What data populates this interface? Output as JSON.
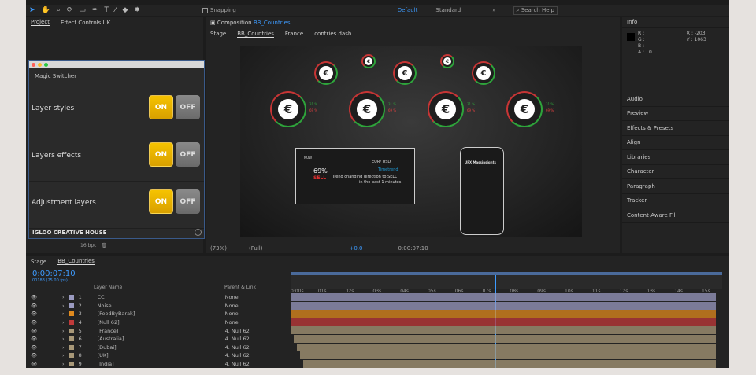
{
  "toolbar": {
    "snapping": "Snapping",
    "workspaces": [
      "Default",
      "Standard"
    ],
    "search": "Search Help"
  },
  "project": {
    "tabs": [
      "Project",
      "Effect Controls UK"
    ]
  },
  "composition": {
    "tab": "Composition",
    "comp": "BB_Countries",
    "breadcrumb": [
      "Stage",
      "BB_Countries",
      "France",
      "contries dash"
    ],
    "zoom": "(73%)",
    "quality": "(Full)",
    "exposure": "+0.0",
    "time": "0:00:07:10"
  },
  "magic": {
    "title": "Magic Switcher",
    "rows": [
      {
        "label": "Layer styles",
        "on": "ON",
        "off": "OFF"
      },
      {
        "label": "Layers effects",
        "on": "ON",
        "off": "OFF"
      },
      {
        "label": "Adjustment layers",
        "on": "ON",
        "off": "OFF"
      }
    ],
    "brand": "IGLOO CREATIVE HOUSE",
    "bpc": "16 bpc"
  },
  "card": {
    "now": "NOW",
    "pair": "EUR/ USD",
    "trend": "Timetrend",
    "pct": "69%",
    "action": "SELL",
    "msg1": "Trend changing direction to SELL",
    "msg2": "in the past 1 minutes"
  },
  "phone": {
    "brand": "UFX Massinsights"
  },
  "coins": {
    "symbol": "€",
    "up": "31 %",
    "down": "69 %"
  },
  "info": {
    "title": "Info",
    "r": "R :",
    "g": "G :",
    "b": "B :",
    "a": "A :",
    "av": "0",
    "x": "X : -203",
    "y": "Y : 1063"
  },
  "panels": [
    "Audio",
    "Preview",
    "Effects & Presets",
    "Align",
    "Libraries",
    "Character",
    "Paragraph",
    "Tracker",
    "Content-Aware Fill"
  ],
  "timeline": {
    "tabs": [
      "Stage",
      "BB_Countries"
    ],
    "time": "0:00:07:10",
    "frames": "00183 (25.00 fps)",
    "col_name": "Layer Name",
    "col_parent": "Parent & Link",
    "ruler": [
      "0:00s",
      "01s",
      "02s",
      "03s",
      "04s",
      "05s",
      "06s",
      "07s",
      "08s",
      "09s",
      "10s",
      "11s",
      "12s",
      "13s",
      "14s",
      "15s"
    ],
    "layers": [
      {
        "n": "1",
        "name": "CC",
        "parent": "None",
        "color": "#9a9ac0"
      },
      {
        "n": "2",
        "name": "Noise",
        "parent": "None",
        "color": "#9a9ac0"
      },
      {
        "n": "3",
        "name": "[FeedByBarak]",
        "parent": "None",
        "color": "#e08a1e"
      },
      {
        "n": "4",
        "name": "[Null 62]",
        "parent": "None",
        "color": "#c03a3a"
      },
      {
        "n": "5",
        "name": "[France]",
        "parent": "4. Null 62",
        "color": "#a89878"
      },
      {
        "n": "6",
        "name": "[Australia]",
        "parent": "4. Null 62",
        "color": "#a89878"
      },
      {
        "n": "7",
        "name": "[Dubai]",
        "parent": "4. Null 62",
        "color": "#a89878"
      },
      {
        "n": "8",
        "name": "[UK]",
        "parent": "4. Null 62",
        "color": "#a89878"
      },
      {
        "n": "9",
        "name": "[India]",
        "parent": "4. Null 62",
        "color": "#a89878"
      }
    ]
  }
}
